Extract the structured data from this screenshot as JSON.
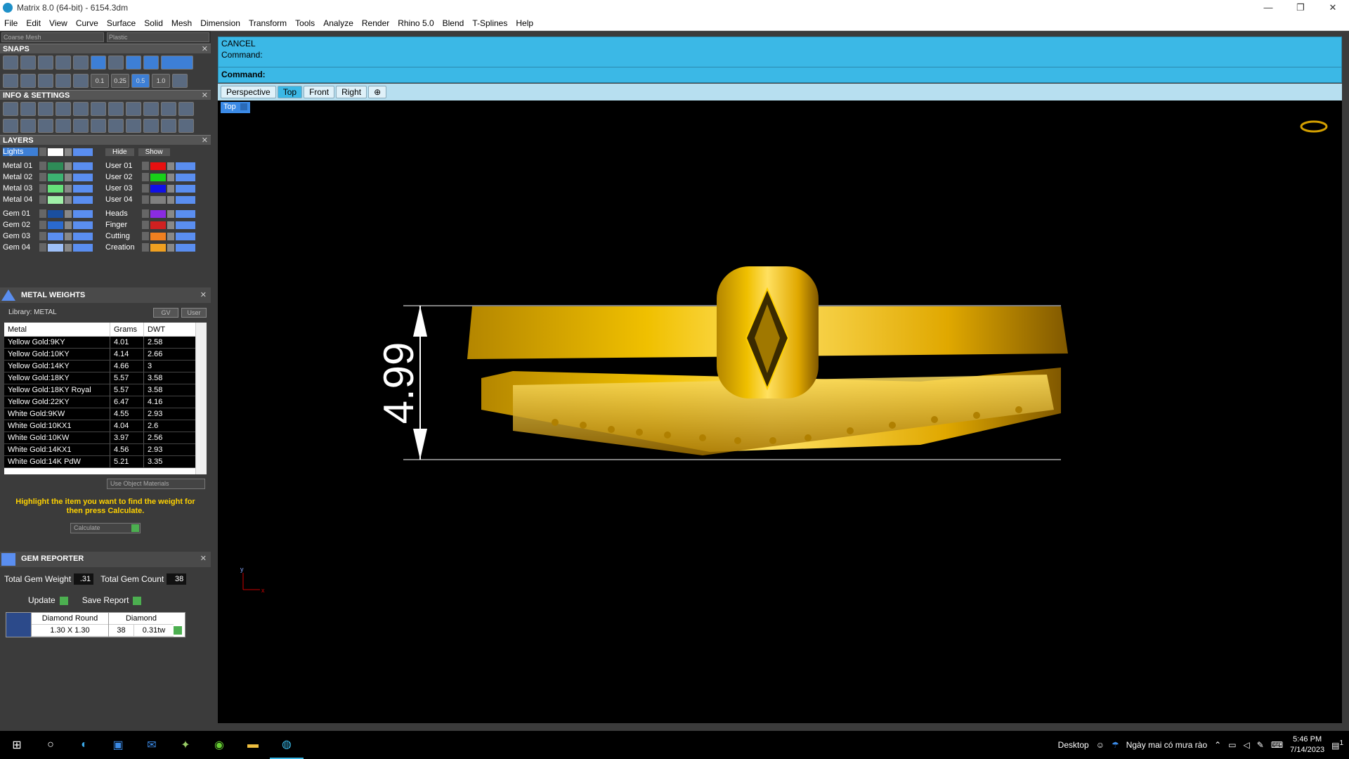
{
  "window": {
    "title": "Matrix 8.0 (64-bit) - 6154.3dm",
    "controls": [
      "—",
      "❐",
      "✕"
    ]
  },
  "menu": [
    "File",
    "Edit",
    "View",
    "Curve",
    "Surface",
    "Solid",
    "Mesh",
    "Dimension",
    "Transform",
    "Tools",
    "Analyze",
    "Render",
    "Rhino 5.0",
    "Blend",
    "T-Splines",
    "Help"
  ],
  "left": {
    "mesh_select": "Coarse Mesh",
    "material_select": "Plastic",
    "snaps_title": "SNAPS",
    "snap_values": [
      "0.1",
      "0.25",
      "0.5",
      "1.0"
    ],
    "info_title": "INFO & SETTINGS",
    "layers_title": "LAYERS",
    "lights_label": "Lights",
    "hide_label": "Hide",
    "show_label": "Show",
    "layers": [
      {
        "left": "Metal 01",
        "lc": "#2e8b57",
        "right": "User 01",
        "rc": "#e81010"
      },
      {
        "left": "Metal 02",
        "lc": "#3cb371",
        "right": "User 02",
        "rc": "#18d018"
      },
      {
        "left": "Metal 03",
        "lc": "#66e07a",
        "right": "User 03",
        "rc": "#1010e8"
      },
      {
        "left": "Metal 04",
        "lc": "#a0f0a8",
        "right": "User 04",
        "rc": "#808080"
      },
      {
        "left": "Gem 01",
        "lc": "#1a4fa0",
        "right": "Heads",
        "rc": "#8a2be2"
      },
      {
        "left": "Gem 02",
        "lc": "#2a6ad0",
        "right": "Finger",
        "rc": "#d02020"
      },
      {
        "left": "Gem 03",
        "lc": "#5a8ef0",
        "right": "Cutting",
        "rc": "#f08020"
      },
      {
        "left": "Gem 04",
        "lc": "#9ec0f8",
        "right": "Creation",
        "rc": "#f0a020"
      }
    ]
  },
  "metal_weights": {
    "title": "METAL WEIGHTS",
    "library": "Library: METAL",
    "gv_label": "GV",
    "user_label": "User",
    "headers": [
      "Metal",
      "Grams",
      "DWT"
    ],
    "rows": [
      [
        "Yellow Gold:9KY",
        "4.01",
        "2.58"
      ],
      [
        "Yellow Gold:10KY",
        "4.14",
        "2.66"
      ],
      [
        "Yellow Gold:14KY",
        "4.66",
        "3"
      ],
      [
        "Yellow Gold:18KY",
        "5.57",
        "3.58"
      ],
      [
        "Yellow Gold:18KY Royal",
        "5.57",
        "3.58"
      ],
      [
        "Yellow Gold:22KY",
        "6.47",
        "4.16"
      ],
      [
        "White Gold:9KW",
        "4.55",
        "2.93"
      ],
      [
        "White Gold:10KX1",
        "4.04",
        "2.6"
      ],
      [
        "White Gold:10KW",
        "3.97",
        "2.56"
      ],
      [
        "White Gold:14KX1",
        "4.56",
        "2.93"
      ],
      [
        "White Gold:14K PdW",
        "5.21",
        "3.35"
      ]
    ],
    "use_object": "Use Object Materials",
    "hint": "Highlight the item you want to find the weight for then press Calculate.",
    "calculate": "Calculate"
  },
  "gem_reporter": {
    "title": "GEM REPORTER",
    "total_weight_label": "Total Gem Weight",
    "total_weight": ".31",
    "total_count_label": "Total Gem Count",
    "total_count": "38",
    "update": "Update",
    "save_report": "Save Report",
    "gem": {
      "type": "Diamond Round",
      "size": "1.30 X 1.30",
      "material": "Diamond",
      "count": "38",
      "tw": "0.31tw"
    }
  },
  "command": {
    "line1": "CANCEL",
    "line2": "Command:",
    "prompt": "Command:"
  },
  "viewport_tabs": [
    "Perspective",
    "Top",
    "Front",
    "Right",
    "⊕"
  ],
  "active_tab": "Top",
  "viewport_label": "Top",
  "dimension_value": "4.99",
  "axis": {
    "y": "y",
    "x": "x"
  },
  "colors": {
    "command_bg": "#3bb8e6",
    "gold": "#e0b000",
    "accent": "#3b8ae6"
  },
  "taskbar": {
    "desktop": "Desktop",
    "weather": "Ngày mai có mưa rào",
    "time": "5:46 PM",
    "date": "7/14/2023",
    "notif": "1"
  }
}
